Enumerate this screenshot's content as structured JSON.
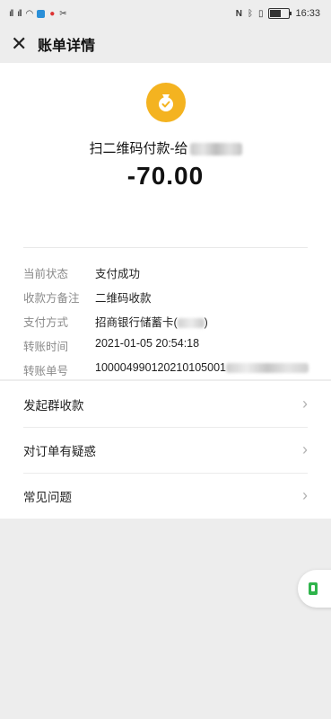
{
  "status_bar": {
    "signal_left": "²    ",
    "signals": [
      "4G",
      "4G"
    ],
    "time": "16:33"
  },
  "nav": {
    "close_icon": "close-icon",
    "title": "账单详情"
  },
  "summary": {
    "icon": "money-bag-icon",
    "icon_color": "#f4b320",
    "payee_prefix": "扫二维码付款-给",
    "amount": "-70.00"
  },
  "details": [
    {
      "label": "当前状态",
      "value": "支付成功"
    },
    {
      "label": "收款方备注",
      "value": "二维码收款"
    },
    {
      "label": "支付方式",
      "value": "招商银行储蓄卡(",
      "suffix": ")"
    },
    {
      "label": "转账时间",
      "value": "2021-01-05 20:54:18"
    },
    {
      "label": "转账单号",
      "value": "100004990120210105001"
    }
  ],
  "menu": [
    {
      "label": "发起群收款"
    },
    {
      "label": "对订单有疑惑"
    },
    {
      "label": "常见问题"
    }
  ],
  "colors": {
    "accent_green": "#2fb44b",
    "background": "#ededed"
  }
}
